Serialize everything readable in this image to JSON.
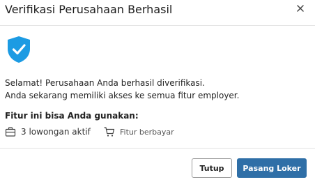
{
  "dialog": {
    "title": "Verifikasi Perusahaan Berhasil",
    "close_icon": "close-icon",
    "badge_icon": "verified-shield-icon",
    "message_line1": "Selamat! Perusahaan Anda berhasil diverifikasi.",
    "message_line2": "Anda sekarang memiliki akses ke semua fitur employer.",
    "features_heading": "Fitur ini bisa Anda gunakan:",
    "features": [
      {
        "icon": "briefcase-icon",
        "label": "3 lowongan aktif"
      },
      {
        "icon": "cart-icon",
        "label": "Fitur berbayar"
      }
    ],
    "buttons": {
      "close_label": "Tutup",
      "primary_label": "Pasang Loker"
    }
  },
  "colors": {
    "accent": "#2f6fa7",
    "shield": "#1c9be3",
    "divider": "#e3e3e3"
  }
}
